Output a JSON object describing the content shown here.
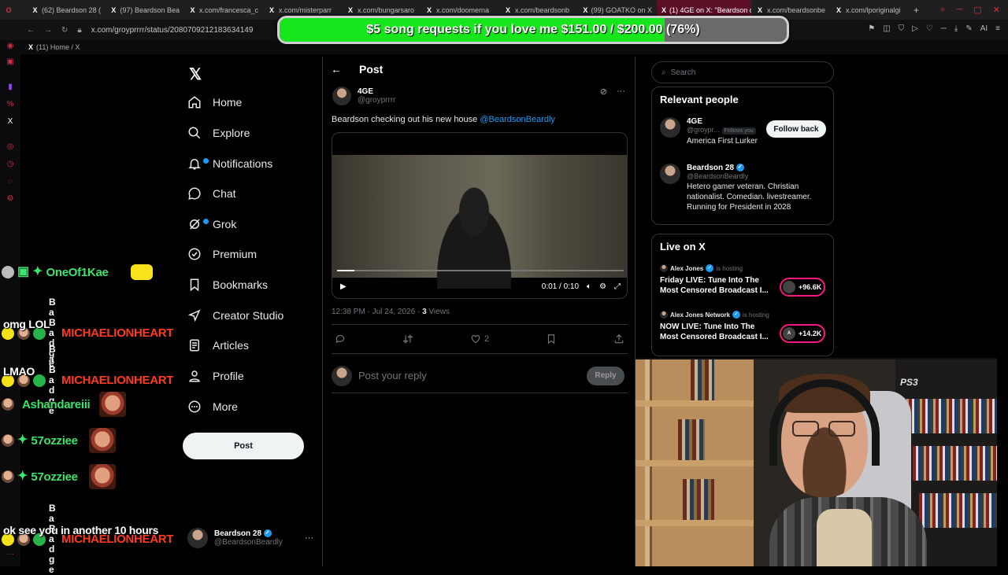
{
  "browser": {
    "tabs": [
      {
        "label": "(62) Beardson 28 (",
        "active": false
      },
      {
        "label": "(97) Beardson Bea",
        "active": false
      },
      {
        "label": "x.com/francesca_c",
        "active": false
      },
      {
        "label": "x.com/misterparr",
        "active": false
      },
      {
        "label": "x.com/bungarsaro",
        "active": false
      },
      {
        "label": "x.com/doomerna",
        "active": false
      },
      {
        "label": "x.com/beardsonb",
        "active": false
      },
      {
        "label": "(99) GOATKO on X",
        "active": false
      },
      {
        "label": "(1) 4GE on X: \"Beardson c",
        "active": true
      },
      {
        "label": "x.com/beardsonbe",
        "active": false
      },
      {
        "label": "x.com/lporiginalgi",
        "active": false
      }
    ],
    "url": "x.com/groyprrrr/status/2080709212183634149",
    "bookmark_label": "(11) Home / X",
    "address_icons": [
      "bookmark-icon",
      "screenshot-icon",
      "shield-icon",
      "play-icon",
      "heart-icon"
    ],
    "ai_label": "AI"
  },
  "donation": {
    "label": "$5 song requests if you love me $151.00 / $200.00 (76%)",
    "progress": 0.76,
    "fill_color": "#18e61c"
  },
  "xnav": {
    "logo": "𝕏",
    "items": [
      {
        "label": "Home",
        "icon": "home-icon"
      },
      {
        "label": "Explore",
        "icon": "search-icon"
      },
      {
        "label": "Notifications",
        "icon": "bell-icon"
      },
      {
        "label": "Chat",
        "icon": "chat-icon"
      },
      {
        "label": "Grok",
        "icon": "grok-icon"
      },
      {
        "label": "Premium",
        "icon": "premium-icon"
      },
      {
        "label": "Bookmarks",
        "icon": "bookmark-icon"
      },
      {
        "label": "Creator Studio",
        "icon": "rocket-icon"
      },
      {
        "label": "Articles",
        "icon": "article-icon"
      },
      {
        "label": "Profile",
        "icon": "person-icon"
      },
      {
        "label": "More",
        "icon": "more-circle-icon"
      }
    ],
    "post_button": "Post",
    "account": {
      "name": "Beardson 28",
      "handle": "@BeardsonBeardly",
      "more": "···"
    }
  },
  "post": {
    "header": "Post",
    "author_name": "4GE",
    "author_handle": "@groyprrrr",
    "text": "Beardson checking out his new house",
    "mention": "@BeardsonBeardly",
    "video": {
      "time": "0:01 / 0:10",
      "progress": 0.06
    },
    "timestamp": "12:38 PM · Jul 24, 2026 · ",
    "views_count": "3",
    "views_label": " Views",
    "likes": "2",
    "reply_placeholder": "Post your reply",
    "reply_button": "Reply"
  },
  "sidebar": {
    "search_placeholder": "Search",
    "relevant_title": "Relevant people",
    "people": [
      {
        "name": "4GE",
        "handle": "@groypr...",
        "follows_you": "Follows you",
        "bio": "America First Lurker"
      },
      {
        "name": "Beardson 28",
        "handle": "@BeardsonBeardly",
        "bio": "Hetero gamer veteran. Christian nationalist. Comedian. livestreamer. Running for President in 2028"
      }
    ],
    "follow_back": "Follow back",
    "live_title": "Live on X",
    "live": [
      {
        "host": "Alex Jones",
        "hosting": "is hosting",
        "title": "Friday LIVE: Tune Into The Most Censored Broadcast I...",
        "count": "+96.6K"
      },
      {
        "host": "Alex Jones Network",
        "hosting": "is hosting",
        "title": "NOW LIVE: Tune Into The Most Censored Broadcast I...",
        "count": "+14.2K"
      }
    ]
  },
  "chat": [
    {
      "user": "OneOf1Kae",
      "color": "#3ce36c",
      "message": ""
    },
    {
      "user": "MICHAELIONHEART",
      "color": "#ff3b1f",
      "message": "omg LOL"
    },
    {
      "user": "MICHAELIONHEART",
      "color": "#ff3b1f",
      "message": "LMAO"
    },
    {
      "user": "Ashandareiii",
      "color": "#3ce36c",
      "message": ""
    },
    {
      "user": "57ozziee",
      "color": "#3ce36c",
      "message": ""
    },
    {
      "user": "57ozziee",
      "color": "#3ce36c",
      "message": ""
    },
    {
      "user": "MICHAELIONHEART",
      "color": "#ff3b1f",
      "message": "ok see you in another 10 hours"
    }
  ],
  "chat_badge_text": "Ba Badge",
  "webcam": {
    "console_label": "PS3"
  },
  "colors": {
    "accent": "#1d9bf0",
    "live": "#f91880",
    "bg": "#000000"
  }
}
